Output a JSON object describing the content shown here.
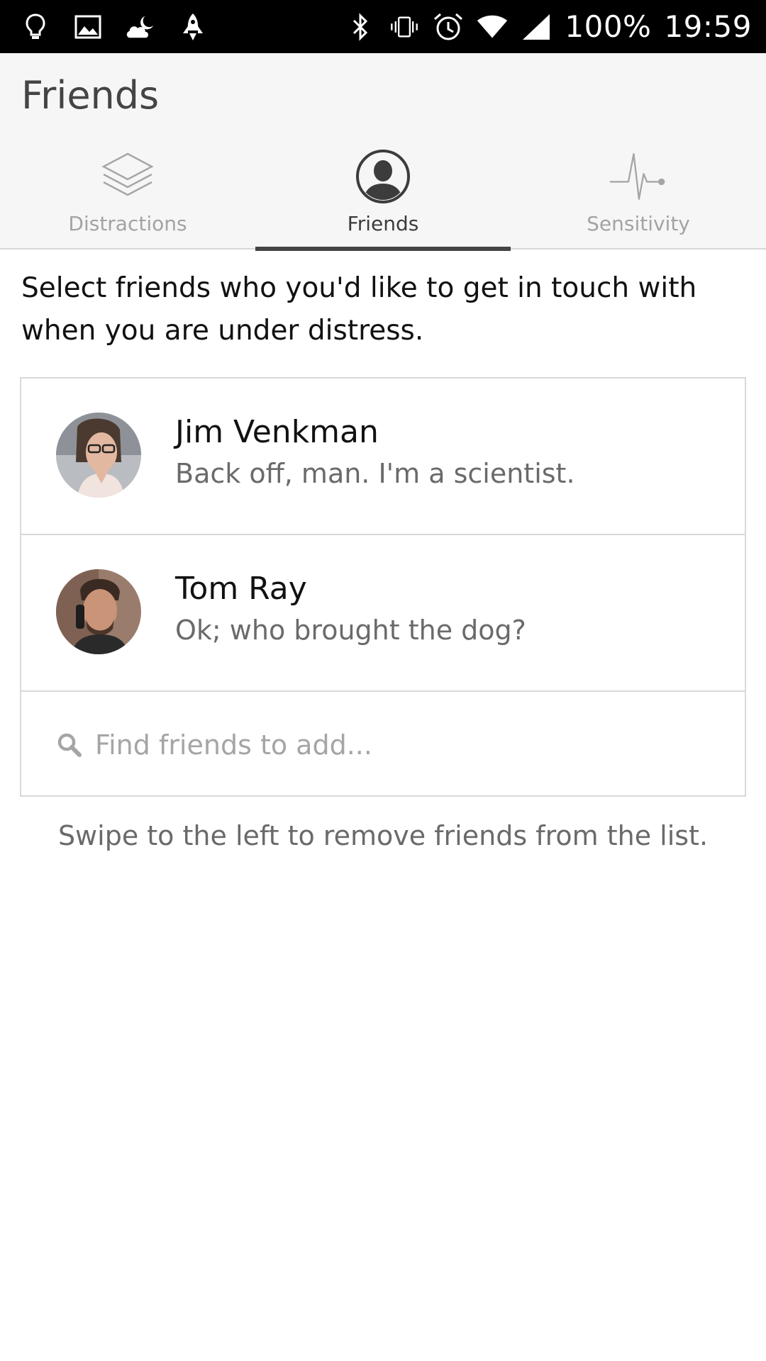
{
  "status_bar": {
    "icons_left": [
      "lightbulb-icon",
      "image-icon",
      "weather-icon",
      "rocket-icon"
    ],
    "icons_right": [
      "bluetooth-icon",
      "vibrate-icon",
      "alarm-icon",
      "wifi-icon",
      "signal-icon"
    ],
    "battery": "100%",
    "time": "19:59"
  },
  "header": {
    "title": "Friends"
  },
  "tabs": [
    {
      "label": "Distractions",
      "icon": "layers-icon",
      "active": false
    },
    {
      "label": "Friends",
      "icon": "person-icon",
      "active": true
    },
    {
      "label": "Sensitivity",
      "icon": "pulse-icon",
      "active": false
    }
  ],
  "main": {
    "intro": "Select friends who you'd like to get in touch with when you are under distress.",
    "friends": [
      {
        "name": "Jim Venkman",
        "status": "Back off, man. I'm a scientist."
      },
      {
        "name": "Tom Ray",
        "status": "Ok; who brought the dog?"
      }
    ],
    "search": {
      "placeholder": "Find friends to add...",
      "value": ""
    },
    "hint": "Swipe to the left to remove friends from the list."
  },
  "colors": {
    "status_bar_bg": "#000000",
    "header_bg": "#f6f6f6",
    "active_tab_indicator": "#444444",
    "inactive_tab_text": "#a3a3a3"
  }
}
